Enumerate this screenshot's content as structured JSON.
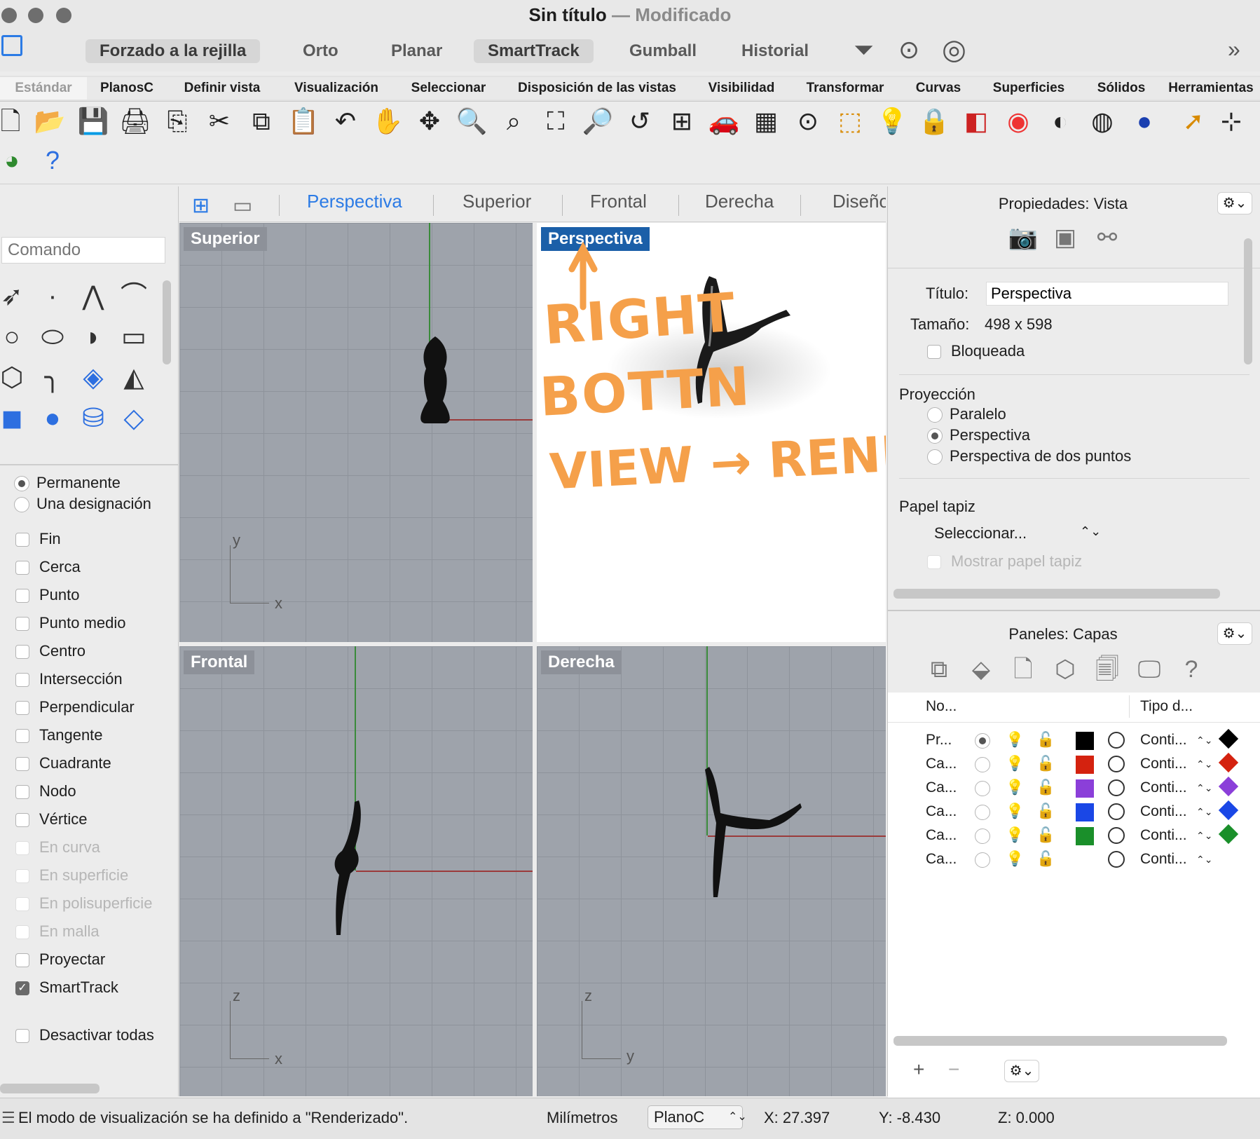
{
  "window": {
    "title": "Sin título",
    "title_separator": "—",
    "subtitle": "Modificado"
  },
  "modes": [
    "Forzado a la rejilla",
    "Orto",
    "Planar",
    "SmartTrack",
    "Gumball",
    "Historial"
  ],
  "tabs": [
    "Estándar",
    "PlanosC",
    "Definir vista",
    "Visualización",
    "Seleccionar",
    "Disposición de las vistas",
    "Visibilidad",
    "Transformar",
    "Curvas",
    "Superficies",
    "Sólidos",
    "Herramientas"
  ],
  "command": {
    "placeholder": "Comando"
  },
  "osnap": {
    "radios": [
      "Permanente",
      "Una designación"
    ],
    "items": [
      {
        "label": "Fin",
        "checked": false,
        "enabled": true
      },
      {
        "label": "Cerca",
        "checked": false,
        "enabled": true
      },
      {
        "label": "Punto",
        "checked": false,
        "enabled": true
      },
      {
        "label": "Punto medio",
        "checked": false,
        "enabled": true
      },
      {
        "label": "Centro",
        "checked": false,
        "enabled": true
      },
      {
        "label": "Intersección",
        "checked": false,
        "enabled": true
      },
      {
        "label": "Perpendicular",
        "checked": false,
        "enabled": true
      },
      {
        "label": "Tangente",
        "checked": false,
        "enabled": true
      },
      {
        "label": "Cuadrante",
        "checked": false,
        "enabled": true
      },
      {
        "label": "Nodo",
        "checked": false,
        "enabled": true
      },
      {
        "label": "Vértice",
        "checked": false,
        "enabled": true
      },
      {
        "label": "En curva",
        "checked": false,
        "enabled": false
      },
      {
        "label": "En superficie",
        "checked": false,
        "enabled": false
      },
      {
        "label": "En polisuperficie",
        "checked": false,
        "enabled": false
      },
      {
        "label": "En malla",
        "checked": false,
        "enabled": false
      },
      {
        "label": "Proyectar",
        "checked": false,
        "enabled": true
      },
      {
        "label": "SmartTrack",
        "checked": true,
        "enabled": true
      }
    ],
    "disable_all": "Desactivar todas"
  },
  "viewport_tabs": [
    "Perspectiva",
    "Superior",
    "Frontal",
    "Derecha",
    "Diseño"
  ],
  "viewports": {
    "top": {
      "label": "Superior",
      "ax1": "y",
      "ax2": "x"
    },
    "persp": {
      "label": "Perspectiva",
      "annotations": [
        "RIGHT",
        "BOTTN",
        "VIEW → RENDER"
      ]
    },
    "front": {
      "label": "Frontal",
      "ax1": "z",
      "ax2": "x"
    },
    "right": {
      "label": "Derecha",
      "ax1": "z",
      "ax2": "y"
    }
  },
  "properties": {
    "header": "Propiedades: Vista",
    "title_label": "Título:",
    "title_value": "Perspectiva",
    "size_label": "Tamaño:",
    "size_value": "498 x 598",
    "locked_label": "Bloqueada",
    "projection_label": "Proyección",
    "projection_options": [
      "Paralelo",
      "Perspectiva",
      "Perspectiva de dos puntos"
    ],
    "projection_selected": 1,
    "wallpaper_label": "Papel tapiz",
    "wallpaper_select": "Seleccionar...",
    "show_wallpaper": "Mostrar papel tapiz"
  },
  "layers": {
    "header": "Paneles: Capas",
    "col_name": "No...",
    "col_type": "Tipo d...",
    "rows": [
      {
        "name": "Pr...",
        "current": true,
        "color": "#000000",
        "linetype": "Conti...",
        "print_color": "#000000"
      },
      {
        "name": "Ca...",
        "current": false,
        "color": "#d4220f",
        "linetype": "Conti...",
        "print_color": "#d4220f"
      },
      {
        "name": "Ca...",
        "current": false,
        "color": "#8b3fd9",
        "linetype": "Conti...",
        "print_color": "#8b3fd9"
      },
      {
        "name": "Ca...",
        "current": false,
        "color": "#1a47e6",
        "linetype": "Conti...",
        "print_color": "#1a47e6"
      },
      {
        "name": "Ca...",
        "current": false,
        "color": "#1a8f2a",
        "linetype": "Conti...",
        "print_color": "#1a8f2a"
      },
      {
        "name": "Ca...",
        "current": false,
        "color": "",
        "linetype": "Conti...",
        "print_color": ""
      }
    ],
    "add": "+",
    "remove": "−"
  },
  "status": {
    "message": "El modo de visualización se ha definido a \"Renderizado\".",
    "units": "Milímetros",
    "cplane": "PlanoC",
    "x": "X: 27.397",
    "y": "Y: -8.430",
    "z": "Z: 0.000"
  },
  "colors": {
    "accent": "#2c7be5",
    "annotation": "#f5a04a",
    "active_viewport": "#1b5fa8"
  }
}
